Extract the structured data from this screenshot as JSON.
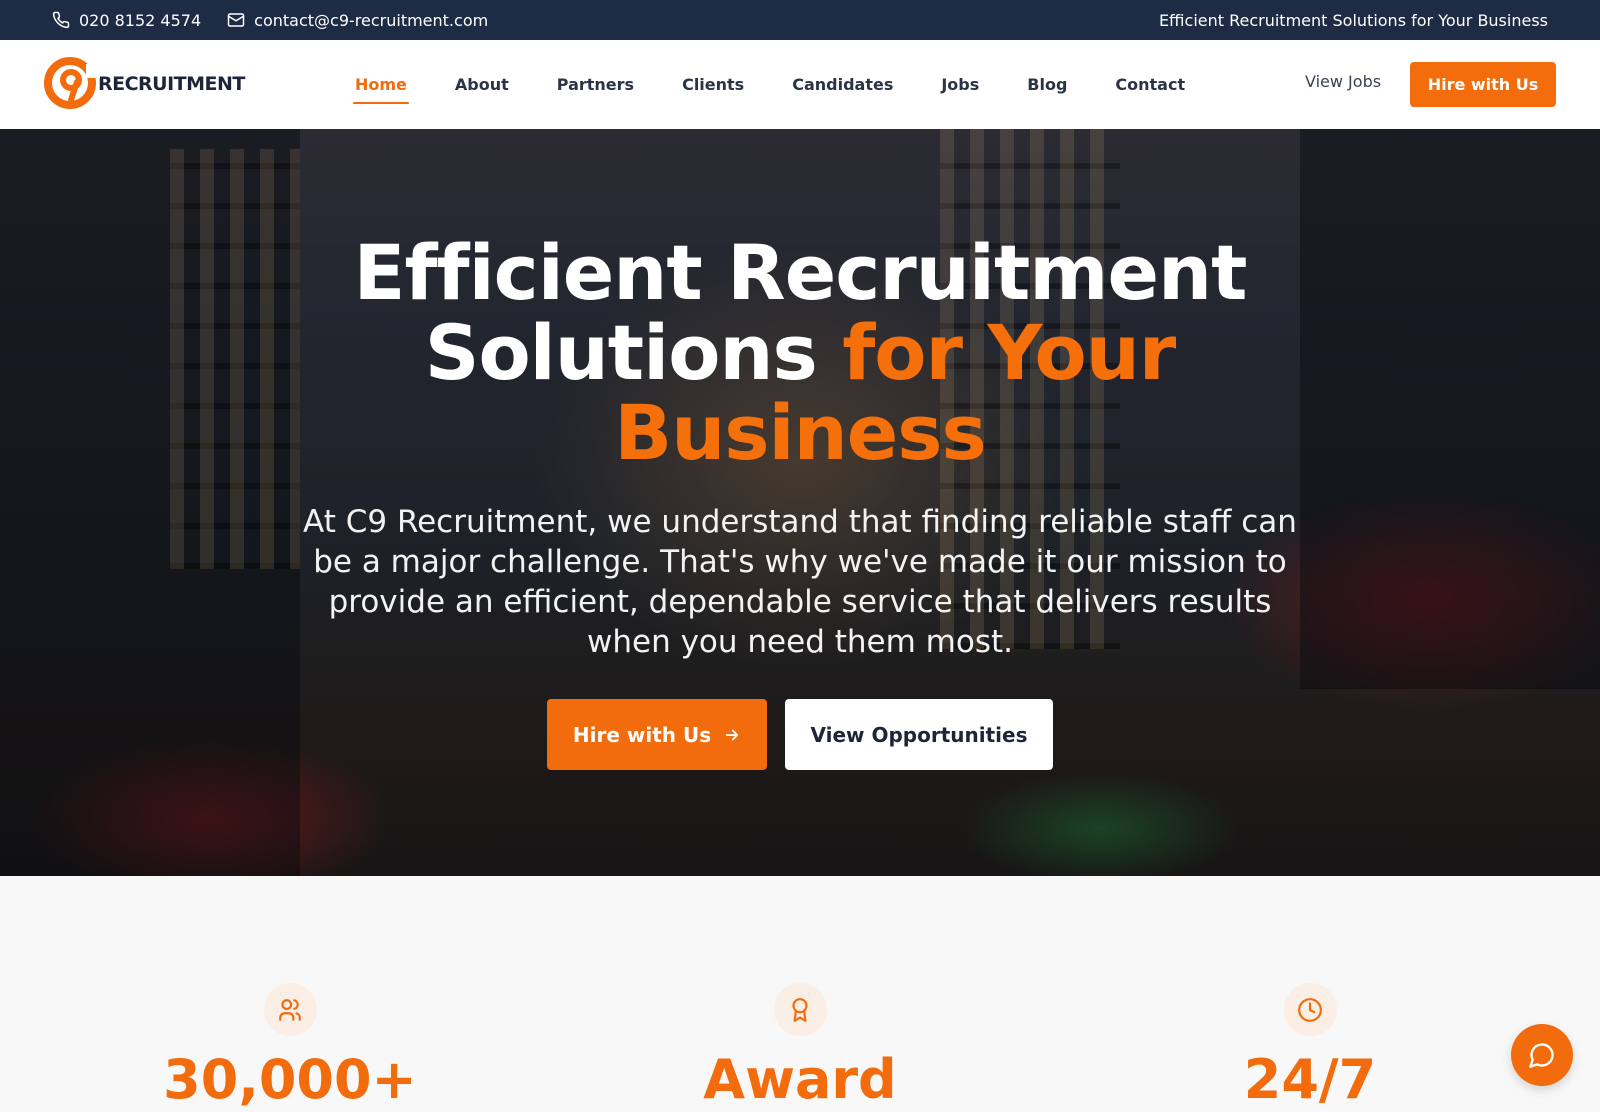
{
  "topbar": {
    "phone": "020 8152 4574",
    "email": "contact@c9-recruitment.com",
    "tagline": "Efficient Recruitment Solutions for Your Business"
  },
  "nav": {
    "logo_text": "RECRUITMENT",
    "items": [
      {
        "label": "Home",
        "active": true
      },
      {
        "label": "About"
      },
      {
        "label": "Partners"
      },
      {
        "label": "Clients"
      },
      {
        "label": "Candidates"
      },
      {
        "label": "Jobs"
      },
      {
        "label": "Blog"
      },
      {
        "label": "Contact"
      }
    ],
    "view_jobs": "View Jobs",
    "hire_button": "Hire with Us"
  },
  "hero": {
    "title_line1": "Efficient Recruitment",
    "title_line2_white": "Solutions ",
    "title_line2_accent": "for Your",
    "title_line3_accent": "Business",
    "description": "At C9 Recruitment, we understand that finding reliable staff can be a major challenge. That's why we've made it our mission to provide an efficient, dependable service that delivers results when you need them most.",
    "primary_button": "Hire with Us",
    "secondary_button": "View Opportunities"
  },
  "stats": [
    {
      "icon": "users-icon",
      "value": "30,000+"
    },
    {
      "icon": "award-icon",
      "value": "Award"
    },
    {
      "icon": "clock-icon",
      "value": "24/7"
    }
  ],
  "colors": {
    "accent": "#f26b0c",
    "topbar_bg": "#1d2b44",
    "dark_text": "#1d2638"
  }
}
